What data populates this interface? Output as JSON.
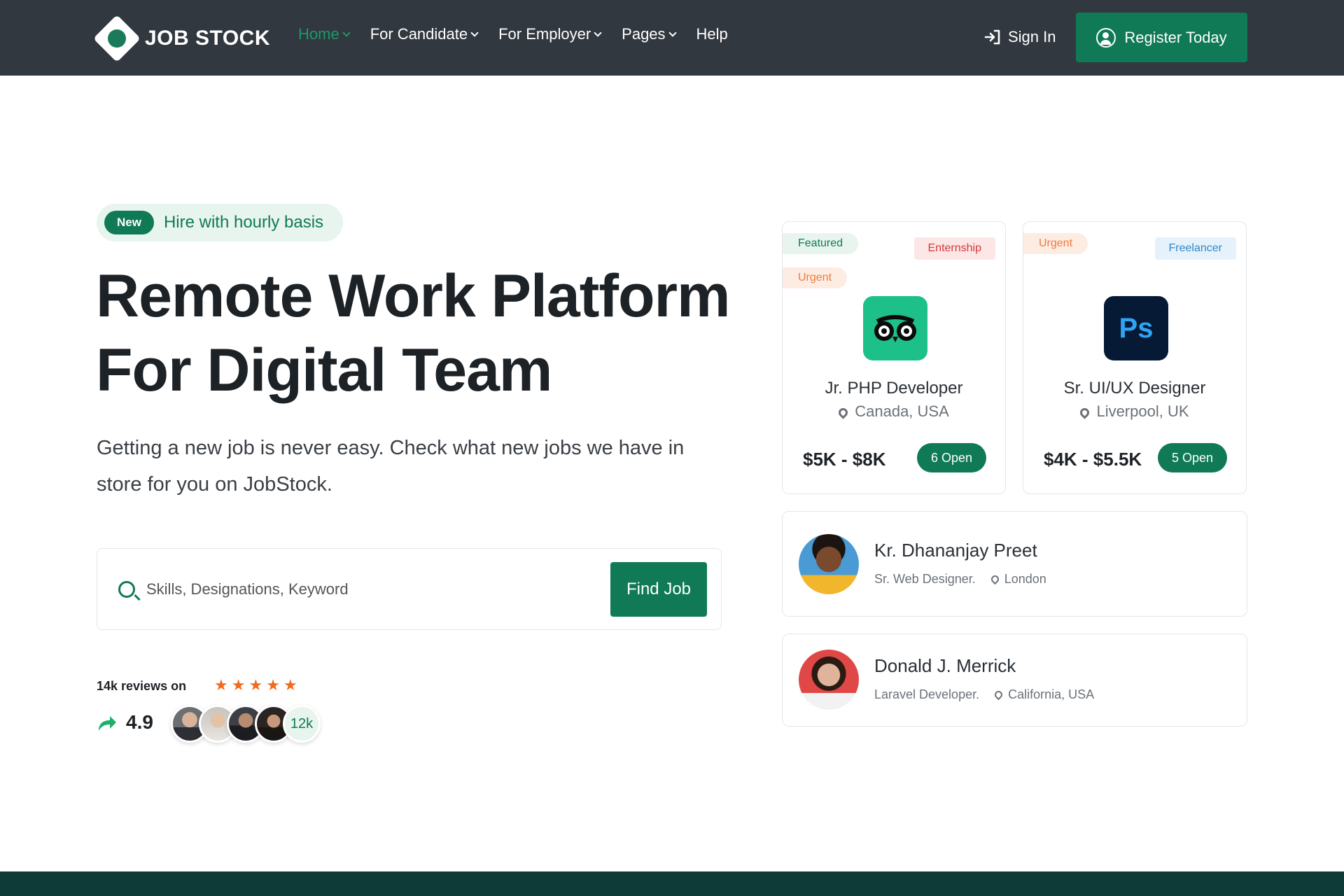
{
  "header": {
    "logo_text": "JOB STOCK",
    "nav": [
      {
        "label": "Home",
        "active": true,
        "dropdown": true
      },
      {
        "label": "For Candidate",
        "active": false,
        "dropdown": true
      },
      {
        "label": "For Employer",
        "active": false,
        "dropdown": true
      },
      {
        "label": "Pages",
        "active": false,
        "dropdown": true
      },
      {
        "label": "Help",
        "active": false,
        "dropdown": false
      }
    ],
    "signin_label": "Sign In",
    "register_label": "Register Today"
  },
  "hero": {
    "badge_new": "New",
    "badge_text": "Hire with hourly basis",
    "title_line1": "Remote Work Platform",
    "title_line2": "For Digital Team",
    "description": "Getting a new job is never easy. Check what new jobs we have in store for you on JobStock.",
    "search_placeholder": "Skills, Designations, Keyword",
    "find_button": "Find Job",
    "reviews_label": "14k reviews on",
    "stars": 5,
    "rating": "4.9",
    "avatars_count": "12k"
  },
  "jobs": [
    {
      "tags_left": [
        "Featured",
        "Urgent"
      ],
      "tag_right": "Enternship",
      "logo_icon": "tripadvisor-owl-icon",
      "title": "Jr. PHP Developer",
      "location": "Canada, USA",
      "salary": "$5K - $8K",
      "open": "6 Open"
    },
    {
      "tags_left": [
        "Urgent"
      ],
      "tag_right": "Freelancer",
      "logo_icon": "photoshop-icon",
      "logo_text": "Ps",
      "title": "Sr. UI/UX Designer",
      "location": "Liverpool, UK",
      "salary": "$4K - $5.5K",
      "open": "5 Open"
    }
  ],
  "people": [
    {
      "name": "Kr. Dhananjay Preet",
      "role": "Sr. Web Designer.",
      "location": "London"
    },
    {
      "name": "Donald J. Merrick",
      "role": "Laravel Developer.",
      "location": "California, USA"
    }
  ],
  "colors": {
    "header_bg": "#323840",
    "accent": "#0f7a55",
    "active_nav": "#1a9a68",
    "star": "#f26b1d",
    "footer": "#0e3a38"
  }
}
